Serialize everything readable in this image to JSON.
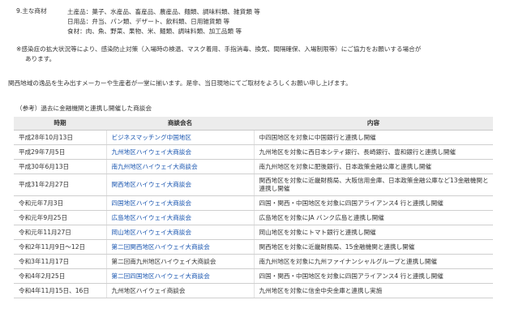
{
  "items": {
    "label": "9.主な商材",
    "lines": [
      "土産品：菓子、水産品、畜産品、農産品、麺類、調味料類、雑貨類 等",
      "日用品：弁当、パン類、デザート、飲料類、日用雑貨類 等",
      "食材：肉、魚、野菜、果物、米、麺類、調味料類、加工品類 等"
    ]
  },
  "notice": {
    "line1": "※感染症の拡大状況等により、感染防止対策（入場時の検温、マスク着用、手指消毒、換気、間隔確保、入場制限等）にご協力をお願いする場合が",
    "line2": "あります。"
  },
  "intro": "関西地域の逸品を生み出すメーカーや生産者が一堂に揃います。是非、当日現地にてご取材をよろしくお願い申し上げます。",
  "ref_title": "（参考）過去に金融機関と連携し開催した商談会",
  "table": {
    "headers": [
      "時期",
      "商談会名",
      "内容"
    ],
    "rows": [
      {
        "date": "平成28年10月13日",
        "name": "ビジネスマッチング中国地区",
        "content": "中四国地区を対象に中国銀行と連携し開催"
      },
      {
        "date": "平成29年7月5日",
        "name": "九州地区ハイウェイ大商談会",
        "content": "九州地区を対象に西日本シティ銀行、長崎銀行、豊和銀行と連携し開催"
      },
      {
        "date": "平成30年6月13日",
        "name": "南九州地区ハイウェイ大商談会",
        "content": "南九州地区を対象に肥後銀行、日本政策金融公庫と連携し開催"
      },
      {
        "date": "平成31年2月27日",
        "name": "関西地区ハイウェイ大商談会",
        "content": "関西地区を対象に近畿財務局、大阪信用金庫、日本政策金融公庫など13金融機関と連携し開催"
      },
      {
        "date": "令和元年7月3日",
        "name": "四国地区ハイウェイ大商談会",
        "content": "四国・関西・中国地区を対象に四国アライアンス4 行と連携し開催"
      },
      {
        "date": "令和元年9月25日",
        "name": "広島地区ハイウェイ大商談会",
        "content": "広島地区を対象にJA バンク広島と連携し開催"
      },
      {
        "date": "令和元年11月27日",
        "name": "岡山地区ハイウェイ大商談会",
        "content": "岡山地区を対象にトマト銀行と連携し開催"
      },
      {
        "date": "令和2年11月9日～12日",
        "name": "第二回関西地区ハイウェイ大商談会",
        "content": "関西地区を対象に近畿財務局、15金融機関と連携し開催"
      },
      {
        "date": "令和3年11月17日",
        "name": "第二回南九州地区ハイウェイ大商談会",
        "content": "南九州地区を対象に九州ファイナンシャルグループと連携し開催"
      },
      {
        "date": "令和4年2月25日",
        "name": "第二回四国地区ハイウェイ大商談会",
        "content": "四国・関西・中国地区を対象に四国アライアンス4 行と連携し開催"
      },
      {
        "date": "令和4年11月15日、16日",
        "name": "九州地区ハイウェイ商談会",
        "content": "九州地区を対象に信金中央金庫と連携し実施"
      }
    ]
  }
}
